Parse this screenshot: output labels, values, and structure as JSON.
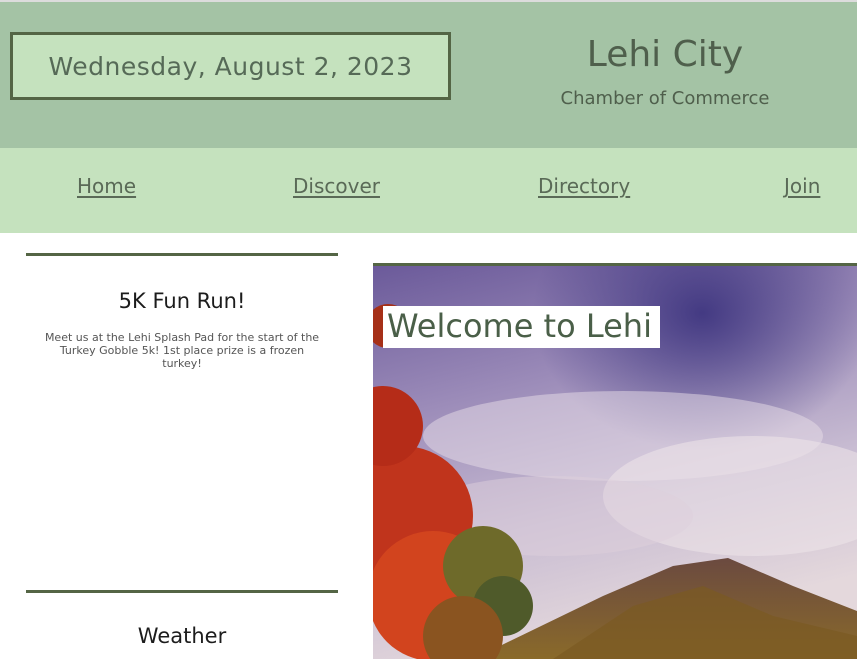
{
  "header": {
    "date": "Wednesday, August 2, 2023",
    "title": "Lehi City",
    "subtitle": "Chamber of Commerce"
  },
  "nav": {
    "items": [
      {
        "label": "Home"
      },
      {
        "label": "Discover"
      },
      {
        "label": "Directory"
      },
      {
        "label": "Join"
      }
    ]
  },
  "sidebar": {
    "event": {
      "title": "5K Fun Run!",
      "body": "Meet us at the Lehi Splash Pad for the start of the Turkey Gobble 5k! 1st place prize is a frozen turkey!"
    },
    "weather": {
      "title": "Weather"
    }
  },
  "hero": {
    "title": "Welcome to Lehi",
    "image": "autumn-mountain-landscape"
  },
  "colors": {
    "header_bg": "#a4c3a5",
    "nav_bg": "#c5e2be",
    "accent_border": "#546545",
    "text_green": "#4f5f4c"
  }
}
